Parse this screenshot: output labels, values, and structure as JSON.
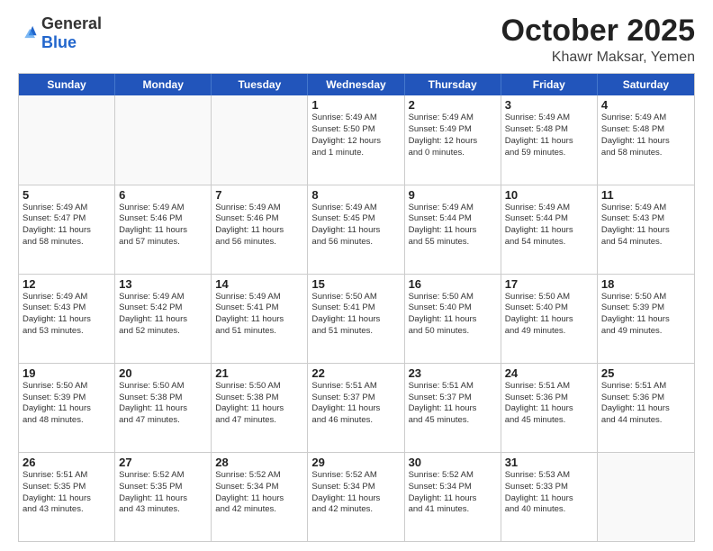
{
  "header": {
    "logo_general": "General",
    "logo_blue": "Blue",
    "month": "October 2025",
    "location": "Khawr Maksar, Yemen"
  },
  "weekdays": [
    "Sunday",
    "Monday",
    "Tuesday",
    "Wednesday",
    "Thursday",
    "Friday",
    "Saturday"
  ],
  "rows": [
    [
      {
        "day": "",
        "info": ""
      },
      {
        "day": "",
        "info": ""
      },
      {
        "day": "",
        "info": ""
      },
      {
        "day": "1",
        "info": "Sunrise: 5:49 AM\nSunset: 5:50 PM\nDaylight: 12 hours\nand 1 minute."
      },
      {
        "day": "2",
        "info": "Sunrise: 5:49 AM\nSunset: 5:49 PM\nDaylight: 12 hours\nand 0 minutes."
      },
      {
        "day": "3",
        "info": "Sunrise: 5:49 AM\nSunset: 5:48 PM\nDaylight: 11 hours\nand 59 minutes."
      },
      {
        "day": "4",
        "info": "Sunrise: 5:49 AM\nSunset: 5:48 PM\nDaylight: 11 hours\nand 58 minutes."
      }
    ],
    [
      {
        "day": "5",
        "info": "Sunrise: 5:49 AM\nSunset: 5:47 PM\nDaylight: 11 hours\nand 58 minutes."
      },
      {
        "day": "6",
        "info": "Sunrise: 5:49 AM\nSunset: 5:46 PM\nDaylight: 11 hours\nand 57 minutes."
      },
      {
        "day": "7",
        "info": "Sunrise: 5:49 AM\nSunset: 5:46 PM\nDaylight: 11 hours\nand 56 minutes."
      },
      {
        "day": "8",
        "info": "Sunrise: 5:49 AM\nSunset: 5:45 PM\nDaylight: 11 hours\nand 56 minutes."
      },
      {
        "day": "9",
        "info": "Sunrise: 5:49 AM\nSunset: 5:44 PM\nDaylight: 11 hours\nand 55 minutes."
      },
      {
        "day": "10",
        "info": "Sunrise: 5:49 AM\nSunset: 5:44 PM\nDaylight: 11 hours\nand 54 minutes."
      },
      {
        "day": "11",
        "info": "Sunrise: 5:49 AM\nSunset: 5:43 PM\nDaylight: 11 hours\nand 54 minutes."
      }
    ],
    [
      {
        "day": "12",
        "info": "Sunrise: 5:49 AM\nSunset: 5:43 PM\nDaylight: 11 hours\nand 53 minutes."
      },
      {
        "day": "13",
        "info": "Sunrise: 5:49 AM\nSunset: 5:42 PM\nDaylight: 11 hours\nand 52 minutes."
      },
      {
        "day": "14",
        "info": "Sunrise: 5:49 AM\nSunset: 5:41 PM\nDaylight: 11 hours\nand 51 minutes."
      },
      {
        "day": "15",
        "info": "Sunrise: 5:50 AM\nSunset: 5:41 PM\nDaylight: 11 hours\nand 51 minutes."
      },
      {
        "day": "16",
        "info": "Sunrise: 5:50 AM\nSunset: 5:40 PM\nDaylight: 11 hours\nand 50 minutes."
      },
      {
        "day": "17",
        "info": "Sunrise: 5:50 AM\nSunset: 5:40 PM\nDaylight: 11 hours\nand 49 minutes."
      },
      {
        "day": "18",
        "info": "Sunrise: 5:50 AM\nSunset: 5:39 PM\nDaylight: 11 hours\nand 49 minutes."
      }
    ],
    [
      {
        "day": "19",
        "info": "Sunrise: 5:50 AM\nSunset: 5:39 PM\nDaylight: 11 hours\nand 48 minutes."
      },
      {
        "day": "20",
        "info": "Sunrise: 5:50 AM\nSunset: 5:38 PM\nDaylight: 11 hours\nand 47 minutes."
      },
      {
        "day": "21",
        "info": "Sunrise: 5:50 AM\nSunset: 5:38 PM\nDaylight: 11 hours\nand 47 minutes."
      },
      {
        "day": "22",
        "info": "Sunrise: 5:51 AM\nSunset: 5:37 PM\nDaylight: 11 hours\nand 46 minutes."
      },
      {
        "day": "23",
        "info": "Sunrise: 5:51 AM\nSunset: 5:37 PM\nDaylight: 11 hours\nand 45 minutes."
      },
      {
        "day": "24",
        "info": "Sunrise: 5:51 AM\nSunset: 5:36 PM\nDaylight: 11 hours\nand 45 minutes."
      },
      {
        "day": "25",
        "info": "Sunrise: 5:51 AM\nSunset: 5:36 PM\nDaylight: 11 hours\nand 44 minutes."
      }
    ],
    [
      {
        "day": "26",
        "info": "Sunrise: 5:51 AM\nSunset: 5:35 PM\nDaylight: 11 hours\nand 43 minutes."
      },
      {
        "day": "27",
        "info": "Sunrise: 5:52 AM\nSunset: 5:35 PM\nDaylight: 11 hours\nand 43 minutes."
      },
      {
        "day": "28",
        "info": "Sunrise: 5:52 AM\nSunset: 5:34 PM\nDaylight: 11 hours\nand 42 minutes."
      },
      {
        "day": "29",
        "info": "Sunrise: 5:52 AM\nSunset: 5:34 PM\nDaylight: 11 hours\nand 42 minutes."
      },
      {
        "day": "30",
        "info": "Sunrise: 5:52 AM\nSunset: 5:34 PM\nDaylight: 11 hours\nand 41 minutes."
      },
      {
        "day": "31",
        "info": "Sunrise: 5:53 AM\nSunset: 5:33 PM\nDaylight: 11 hours\nand 40 minutes."
      },
      {
        "day": "",
        "info": ""
      }
    ]
  ]
}
